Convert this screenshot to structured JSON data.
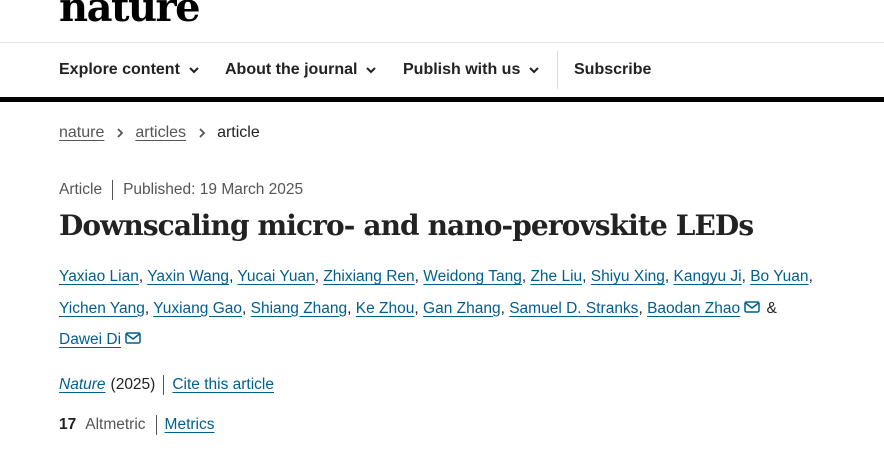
{
  "masthead": {
    "logo": "nature"
  },
  "nav": {
    "items": [
      {
        "label": "Explore content",
        "has_dropdown": true
      },
      {
        "label": "About the journal",
        "has_dropdown": true
      },
      {
        "label": "Publish with us",
        "has_dropdown": true
      }
    ],
    "subscribe": "Subscribe"
  },
  "breadcrumb": {
    "items": [
      "nature",
      "articles"
    ],
    "current": "article"
  },
  "meta": {
    "type": "Article",
    "published": "Published: 19 March 2025"
  },
  "article": {
    "title": "Downscaling micro- and nano-perovskite LEDs"
  },
  "authors": {
    "names": [
      "Yaxiao Lian",
      "Yaxin Wang",
      "Yucai Yuan",
      "Zhixiang Ren",
      "Weidong Tang",
      "Zhe Liu",
      "Shiyu Xing",
      "Kangyu Ji",
      "Bo Yuan",
      "Yichen Yang",
      "Yuxiang Gao",
      "Shiang Zhang",
      "Ke Zhou",
      "Gan Zhang",
      "Samuel D. Stranks",
      "Baodan Zhao",
      "Dawei Di"
    ],
    "separator": ", ",
    "conjunction": " & "
  },
  "journal": {
    "name": "Nature",
    "year": "(2025)",
    "cite": "Cite this article"
  },
  "metrics": {
    "altmetric_score": "17",
    "altmetric_label": "Altmetric",
    "metrics_link": "Metrics"
  },
  "colors": {
    "link": "#025e8d",
    "text": "#222222",
    "muted": "#555555",
    "rule": "#000000"
  }
}
